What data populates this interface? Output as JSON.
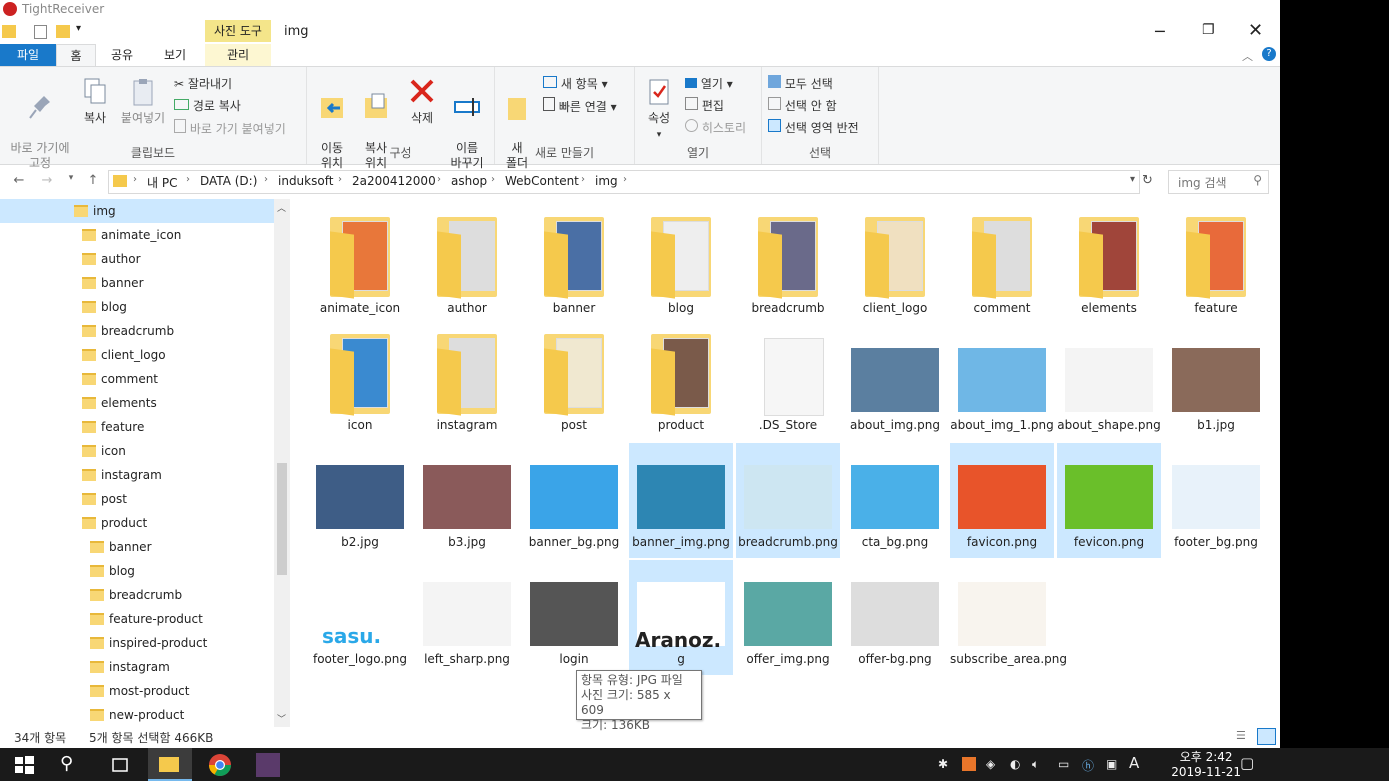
{
  "app": {
    "title": "TightReceiver"
  },
  "window": {
    "title": "img",
    "context_group": "사진 도구"
  },
  "ribbon_tabs": {
    "file": "파일",
    "home": "홈",
    "share": "공유",
    "view": "보기",
    "manage": "관리"
  },
  "ribbon": {
    "clipboard": {
      "name": "클립보드",
      "pin": "바로 가기에\n고정",
      "copy": "복사",
      "paste": "붙여넣기",
      "cut": "잘라내기",
      "copy_path": "경로 복사",
      "paste_shortcut": "바로 가기 붙여넣기"
    },
    "organize": {
      "name": "구성",
      "move_to": "이동\n위치",
      "copy_to": "복사\n위치",
      "delete": "삭제",
      "rename": "이름\n바꾸기"
    },
    "new": {
      "name": "새로 만들기",
      "new_folder": "새\n폴더",
      "new_item": "새 항목",
      "easy_access": "빠른 연결"
    },
    "open": {
      "name": "열기",
      "properties": "속성",
      "open": "열기",
      "edit": "편집",
      "history": "히스토리"
    },
    "select": {
      "name": "선택",
      "select_all": "모두 선택",
      "select_none": "선택 안 함",
      "invert": "선택 영역 반전"
    }
  },
  "address": {
    "crumbs": [
      "내 PC",
      "DATA (D:)",
      "induksoft",
      "2a200412000",
      "ashop",
      "WebContent",
      "img"
    ],
    "search_placeholder": "img 검색"
  },
  "nav_items": [
    {
      "label": "img",
      "selected": true
    },
    {
      "label": "animate_icon"
    },
    {
      "label": "author"
    },
    {
      "label": "banner"
    },
    {
      "label": "blog"
    },
    {
      "label": "breadcrumb"
    },
    {
      "label": "client_logo"
    },
    {
      "label": "comment"
    },
    {
      "label": "elements"
    },
    {
      "label": "feature"
    },
    {
      "label": "icon"
    },
    {
      "label": "instagram"
    },
    {
      "label": "post"
    },
    {
      "label": "product"
    },
    {
      "label": "banner"
    },
    {
      "label": "blog"
    },
    {
      "label": "breadcrumb"
    },
    {
      "label": "feature-product"
    },
    {
      "label": "inspired-product"
    },
    {
      "label": "instagram"
    },
    {
      "label": "most-product"
    },
    {
      "label": "new-product"
    }
  ],
  "files": [
    {
      "name": "animate_icon",
      "kind": "folder"
    },
    {
      "name": "author",
      "kind": "folder"
    },
    {
      "name": "banner",
      "kind": "folder"
    },
    {
      "name": "blog",
      "kind": "folder"
    },
    {
      "name": "breadcrumb",
      "kind": "folder"
    },
    {
      "name": "client_logo",
      "kind": "folder"
    },
    {
      "name": "comment",
      "kind": "folder"
    },
    {
      "name": "elements",
      "kind": "folder"
    },
    {
      "name": "feature",
      "kind": "folder"
    },
    {
      "name": "icon",
      "kind": "folder"
    },
    {
      "name": "instagram",
      "kind": "folder"
    },
    {
      "name": "post",
      "kind": "folder"
    },
    {
      "name": "product",
      "kind": "folder"
    },
    {
      "name": ".DS_Store",
      "kind": "file"
    },
    {
      "name": "about_img.png",
      "kind": "image"
    },
    {
      "name": "about_img_1.png",
      "kind": "image"
    },
    {
      "name": "about_shape.png",
      "kind": "image"
    },
    {
      "name": "b1.jpg",
      "kind": "image"
    },
    {
      "name": "b2.jpg",
      "kind": "image"
    },
    {
      "name": "b3.jpg",
      "kind": "image"
    },
    {
      "name": "banner_bg.png",
      "kind": "image"
    },
    {
      "name": "banner_img.png",
      "kind": "image",
      "selected": true
    },
    {
      "name": "breadcrumb.png",
      "kind": "image",
      "selected": true
    },
    {
      "name": "cta_bg.png",
      "kind": "image"
    },
    {
      "name": "favicon.png",
      "kind": "image",
      "selected": true
    },
    {
      "name": "fevicon.png",
      "kind": "image",
      "selected": true
    },
    {
      "name": "footer_bg.png",
      "kind": "image"
    },
    {
      "name": "footer_logo.png",
      "kind": "image"
    },
    {
      "name": "left_sharp.png",
      "kind": "image"
    },
    {
      "name": "login",
      "kind": "image"
    },
    {
      "name": "g",
      "kind": "image",
      "selected": true
    },
    {
      "name": "offer_img.png",
      "kind": "image"
    },
    {
      "name": "offer-bg.png",
      "kind": "image"
    },
    {
      "name": "subscribe_area.png",
      "kind": "image"
    }
  ],
  "tooltip": {
    "line1": "항목 유형: JPG 파일",
    "line2": "사진 크기: 585 x 609",
    "line3": "크기: 136KB"
  },
  "status": {
    "count": "34개 항목",
    "selection": "5개 항목 선택함 466KB"
  },
  "clock": {
    "time": "오후 2:42",
    "date": "2019-11-21"
  },
  "tray": {
    "ime": "A"
  },
  "thumb_text": {
    "sasu": "sasu.",
    "aranoz": "Aranoz."
  }
}
